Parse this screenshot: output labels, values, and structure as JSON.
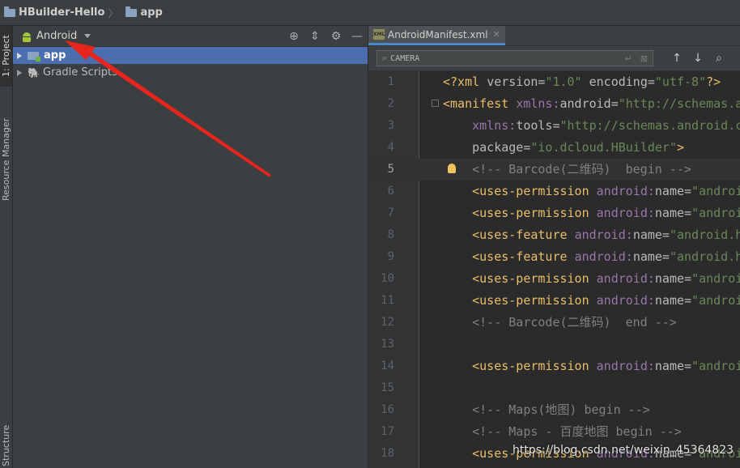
{
  "breadcrumb": {
    "project": "HBuilder-Hello",
    "module": "app"
  },
  "side_tabs": {
    "project": "1: Project",
    "resource": "Resource Manager",
    "structure": "Structure"
  },
  "project_panel": {
    "view_label": "Android",
    "tree": [
      {
        "label": "app",
        "selected": true
      },
      {
        "label": "Gradle Scripts",
        "selected": false
      }
    ]
  },
  "editor": {
    "tab": {
      "label": "AndroidManifest.xml",
      "badge": "XML"
    },
    "search": {
      "value": "CAMERA"
    },
    "lines": [
      {
        "n": "1",
        "text": "<?xml version=\"1.0\" encoding=\"utf-8\"?>"
      },
      {
        "n": "2",
        "text": "<manifest xmlns:android=\"http://schemas.a"
      },
      {
        "n": "3",
        "text": "    xmlns:tools=\"http://schemas.android.c"
      },
      {
        "n": "4",
        "text": "    package=\"io.dcloud.HBuilder\">"
      },
      {
        "n": "5",
        "text": "    <!-- Barcode(二维码)  begin -->"
      },
      {
        "n": "6",
        "text": "    <uses-permission android:name=\"androi"
      },
      {
        "n": "7",
        "text": "    <uses-permission android:name=\"androi"
      },
      {
        "n": "8",
        "text": "    <uses-feature android:name=\"android.h"
      },
      {
        "n": "9",
        "text": "    <uses-feature android:name=\"android.h"
      },
      {
        "n": "10",
        "text": "    <uses-permission android:name=\"androi"
      },
      {
        "n": "11",
        "text": "    <uses-permission android:name=\"androi"
      },
      {
        "n": "12",
        "text": "    <!-- Barcode(二维码)  end -->"
      },
      {
        "n": "13",
        "text": ""
      },
      {
        "n": "14",
        "text": "    <uses-permission android:name=\"androi"
      },
      {
        "n": "15",
        "text": ""
      },
      {
        "n": "16",
        "text": "    <!-- Maps(地图) begin -->"
      },
      {
        "n": "17",
        "text": "    <!-- Maps - 百度地图 begin -->"
      },
      {
        "n": "18",
        "text": "    <uses-permission android:name=\"androi"
      }
    ],
    "current_line": "5"
  },
  "watermark": "https://blog.csdn.net/weixin_45364823",
  "colors": {
    "selection": "#4b6eaf",
    "annotation_arrow": "#e8251c",
    "tag": "#e8bf6a",
    "string": "#6a8759",
    "namespace": "#9876aa",
    "comment": "#808080"
  }
}
